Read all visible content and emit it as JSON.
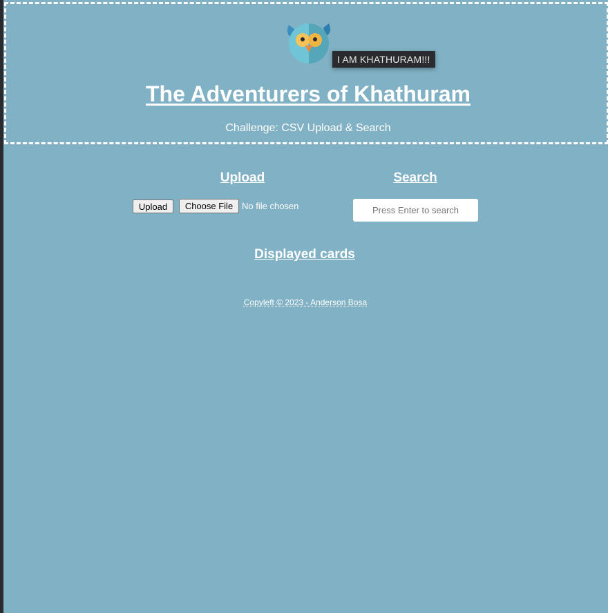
{
  "header": {
    "logo_icon": "owl-icon",
    "tooltip": "I AM KHATHURAM!!!",
    "title": "The Adventurers of Khathuram",
    "subtitle": "Challenge: CSV Upload & Search"
  },
  "upload": {
    "heading": "Upload",
    "upload_label": "Upload",
    "choose_file_label": "Choose File",
    "file_status": "No file chosen"
  },
  "search": {
    "heading": "Search",
    "placeholder": "Press Enter to search",
    "value": ""
  },
  "cards": {
    "heading": "Displayed cards"
  },
  "footer": {
    "text": "Copyleft © 2023 - Anderson Bosa"
  },
  "colors": {
    "background": "#80b1c4",
    "tooltip_bg": "#2a2b2f",
    "text": "#ffffff"
  }
}
